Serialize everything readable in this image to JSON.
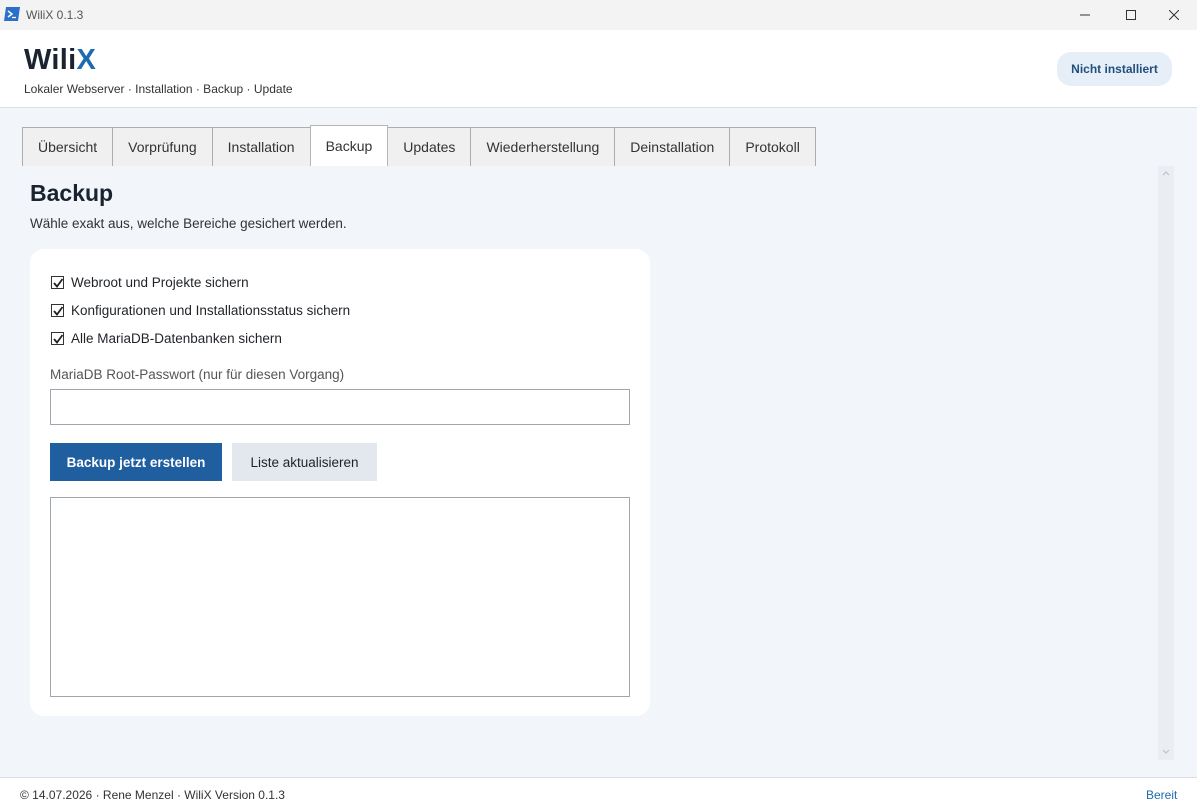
{
  "window": {
    "title": "WiliX 0.1.3"
  },
  "header": {
    "logo_main": "Wili",
    "logo_accent": "X",
    "subtitle": "Lokaler Webserver · Installation · Backup · Update",
    "status": "Nicht installiert"
  },
  "tabs": [
    {
      "label": "Übersicht",
      "active": false
    },
    {
      "label": "Vorprüfung",
      "active": false
    },
    {
      "label": "Installation",
      "active": false
    },
    {
      "label": "Backup",
      "active": true
    },
    {
      "label": "Updates",
      "active": false
    },
    {
      "label": "Wiederherstellung",
      "active": false
    },
    {
      "label": "Deinstallation",
      "active": false
    },
    {
      "label": "Protokoll",
      "active": false
    }
  ],
  "page": {
    "title": "Backup",
    "description": "Wähle exakt aus, welche Bereiche gesichert werden."
  },
  "options": [
    {
      "label": "Webroot und Projekte sichern",
      "checked": true
    },
    {
      "label": "Konfigurationen und Installationsstatus sichern",
      "checked": true
    },
    {
      "label": "Alle MariaDB-Datenbanken sichern",
      "checked": true
    }
  ],
  "password": {
    "label": "MariaDB Root-Passwort (nur für diesen Vorgang)",
    "value": ""
  },
  "buttons": {
    "create_backup": "Backup jetzt erstellen",
    "refresh_list": "Liste aktualisieren"
  },
  "footer": {
    "left": "© 14.07.2026 · Rene Menzel · WiliX Version 0.1.3",
    "right": "Bereit"
  },
  "colors": {
    "accent": "#1f6bb0",
    "primary_button": "#1f5fa0",
    "background": "#f2f5f9"
  }
}
